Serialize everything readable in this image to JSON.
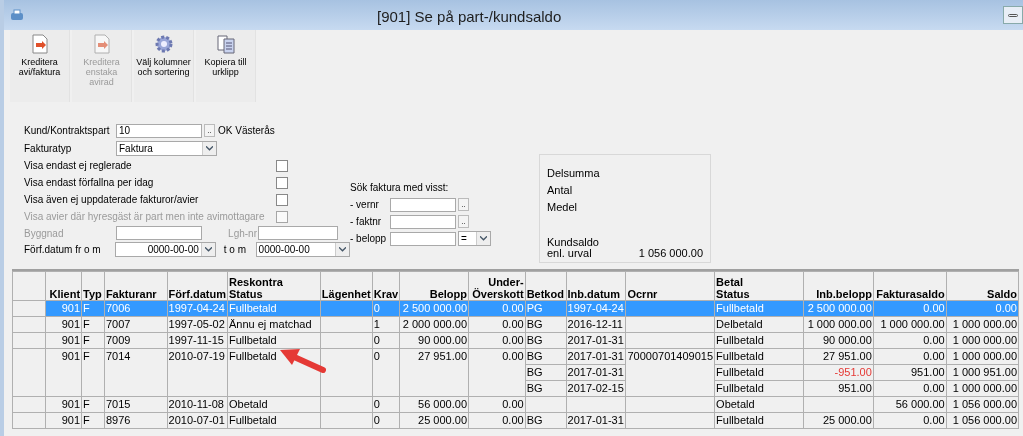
{
  "window": {
    "title": "[901]  Se på part-/kundsaldo"
  },
  "toolbar": [
    {
      "label": "Kreditera avi/faktura",
      "kind": "credit",
      "disabled": false
    },
    {
      "label": "Kreditera enstaka avirad",
      "kind": "credit",
      "disabled": true
    },
    {
      "label": "Välj kolumner och sortering",
      "kind": "gear",
      "disabled": false
    },
    {
      "label": "Kopiera till urklipp",
      "kind": "copy",
      "disabled": false
    }
  ],
  "form": {
    "customer": {
      "label": "Kund/Kontraktspart",
      "value": "10",
      "browse": "..",
      "name": "OK Västerås"
    },
    "invoice_type": {
      "label": "Fakturatyp",
      "value": "Faktura"
    },
    "checkboxes": [
      {
        "label": "Visa endast ej reglerade",
        "checked": false,
        "disabled": false
      },
      {
        "label": "Visa endast förfallna per idag",
        "checked": false,
        "disabled": false
      },
      {
        "label": "Visa även ej uppdaterade fakturor/avier",
        "checked": false,
        "disabled": false
      },
      {
        "label": "Visa avier där hyresgäst är part men inte avimottagare",
        "checked": false,
        "disabled": true
      }
    ],
    "building": {
      "label": "Byggnad"
    },
    "apartment": {
      "label": "Lgh-nr"
    },
    "date_from": {
      "label": "Förf.datum fr o m",
      "value": "0000-00-00"
    },
    "date_to": {
      "label": "t o m",
      "value": "0000-00-00"
    }
  },
  "search": {
    "heading": "Sök faktura med visst:",
    "fields": [
      {
        "label": "- vernr",
        "kind": "lookup",
        "browse": ".."
      },
      {
        "label": "- faktnr",
        "kind": "lookup",
        "browse": ".."
      },
      {
        "label": "- belopp",
        "kind": "operator",
        "operator": "="
      }
    ]
  },
  "summary": {
    "rows": [
      "Delsumma",
      "Antal",
      "Medel"
    ],
    "total_label": [
      "Kundsaldo",
      "enl. urval"
    ],
    "total_value": "1 056 000.00"
  },
  "table": {
    "columns": [
      "Klient",
      "Typ",
      "Fakturanr",
      "Förf.datum",
      "Reskontra\nStatus",
      "Lägenhet",
      "Krav",
      "Belopp",
      "Under-\nÖverskott",
      "Betkod",
      "Inb.datum",
      "Ocrnr",
      "Betal\nStatus",
      "Inb.belopp",
      "Fakturasaldo",
      "Saldo"
    ],
    "rows": [
      {
        "selected": true,
        "klient": "901",
        "typ": "F",
        "fakturanr": "7006",
        "forf_datum": "1997-04-24",
        "status": "Fullbetald",
        "krav": "0",
        "belopp": "2 500 000.00",
        "over": "0.00",
        "payments": [
          {
            "betkod": "PG",
            "inb_datum": "1997-04-24",
            "betal_status": "Fullbetald",
            "inb_belopp": "2 500 000.00",
            "negative": false,
            "fakturasaldo": "0.00",
            "saldo": "0.00"
          }
        ]
      },
      {
        "selected": false,
        "klient": "901",
        "typ": "F",
        "fakturanr": "7007",
        "forf_datum": "1997-05-02",
        "status": "Ännu ej matchad",
        "krav": "1",
        "belopp": "2 000 000.00",
        "over": "0.00",
        "payments": [
          {
            "betkod": "BG",
            "inb_datum": "2016-12-11",
            "betal_status": "Delbetald",
            "inb_belopp": "1 000 000.00",
            "negative": false,
            "fakturasaldo": "1 000 000.00",
            "saldo": "1 000 000.00"
          }
        ]
      },
      {
        "selected": false,
        "klient": "901",
        "typ": "F",
        "fakturanr": "7009",
        "forf_datum": "1997-11-15",
        "status": "Fullbetald",
        "krav": "0",
        "belopp": "90 000.00",
        "over": "0.00",
        "payments": [
          {
            "betkod": "BG",
            "inb_datum": "2017-01-31",
            "betal_status": "Fullbetald",
            "inb_belopp": "90 000.00",
            "negative": false,
            "fakturasaldo": "0.00",
            "saldo": "1 000 000.00"
          }
        ]
      },
      {
        "selected": false,
        "klient": "901",
        "typ": "F",
        "fakturanr": "7014",
        "forf_datum": "2010-07-19",
        "status": "Fullbetald",
        "krav": "0",
        "belopp": "27 951.00",
        "over": "0.00",
        "ocrnr": "70000701409015",
        "payments": [
          {
            "betkod": "BG",
            "inb_datum": "2017-01-31",
            "betal_status": "Fullbetald",
            "inb_belopp": "27 951.00",
            "negative": false,
            "fakturasaldo": "0.00",
            "saldo": "1 000 000.00"
          },
          {
            "betkod": "BG",
            "inb_datum": "2017-01-31",
            "betal_status": "Fullbetald",
            "inb_belopp": "-951.00",
            "negative": true,
            "fakturasaldo": "951.00",
            "saldo": "1 000 951.00"
          },
          {
            "betkod": "BG",
            "inb_datum": "2017-02-15",
            "betal_status": "Fullbetald",
            "inb_belopp": "951.00",
            "negative": false,
            "fakturasaldo": "0.00",
            "saldo": "1 000 000.00"
          }
        ]
      },
      {
        "selected": false,
        "klient": "901",
        "typ": "F",
        "fakturanr": "7015",
        "forf_datum": "2010-11-08",
        "status": "Obetald",
        "krav": "0",
        "belopp": "56 000.00",
        "over": "0.00",
        "payments": [
          {
            "betal_status": "Obetald",
            "negative": false,
            "fakturasaldo": "56 000.00",
            "saldo": "1 056 000.00"
          }
        ]
      },
      {
        "selected": false,
        "klient": "901",
        "typ": "F",
        "fakturanr": "8976",
        "forf_datum": "2010-07-01",
        "status": "Fullbetald",
        "krav": "0",
        "belopp": "25 000.00",
        "over": "0.00",
        "payments": [
          {
            "betkod": "BG",
            "inb_datum": "2017-01-31",
            "betal_status": "Fullbetald",
            "inb_belopp": "25 000.00",
            "negative": false,
            "fakturasaldo": "0.00",
            "saldo": "1 056 000.00"
          }
        ]
      }
    ]
  }
}
